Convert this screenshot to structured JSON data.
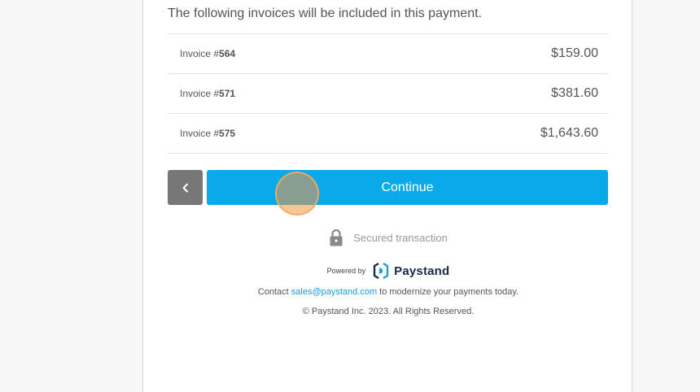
{
  "intro_text": "The following invoices will be included in this payment.",
  "invoices": [
    {
      "prefix": "Invoice #",
      "number": "564",
      "amount": "$159.00"
    },
    {
      "prefix": "Invoice #",
      "number": "571",
      "amount": "$381.60"
    },
    {
      "prefix": "Invoice #",
      "number": "575",
      "amount": "$1,643.60"
    }
  ],
  "actions": {
    "back_icon": "chevron-left-icon",
    "continue_label": "Continue"
  },
  "secured": {
    "icon": "lock-icon",
    "label": "Secured transaction"
  },
  "branding": {
    "powered_by": "Powered by",
    "brand_name": "Paystand",
    "logo_icon": "paystand-logo-icon"
  },
  "contact": {
    "before": "Contact ",
    "email": "sales@paystand.com",
    "after": " to modernize your payments today."
  },
  "copyright": "© Paystand Inc. 2023. All Rights Reserved.",
  "colors": {
    "primary": "#0aa9ea",
    "back_button": "#777777",
    "link": "#1a9ad9",
    "brand_dark": "#1b2a4a"
  }
}
